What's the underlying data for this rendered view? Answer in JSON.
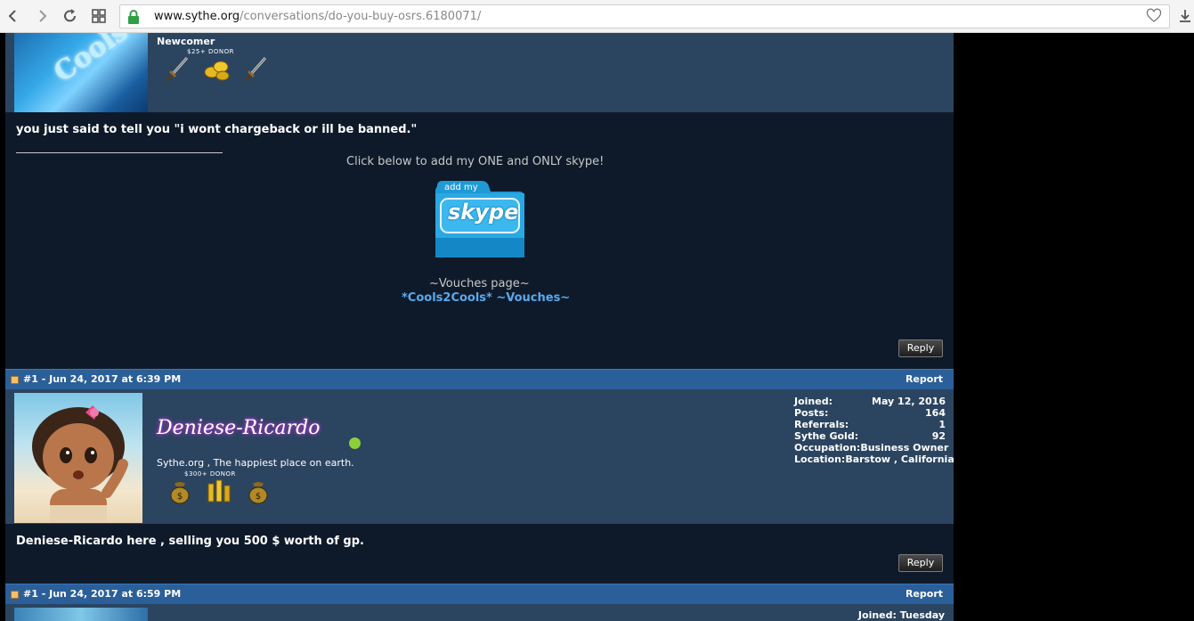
{
  "browser": {
    "url_host": "www.sythe.org",
    "url_path": "/conversations/do-you-buy-osrs.6180071/"
  },
  "post1": {
    "rank": "Newcomer",
    "badge_label": "$25+ DONOR",
    "message": "you just said to tell you \"i wont chargeback or ill be banned.\"",
    "signature": {
      "line1": "Click below to add my ONE and ONLY skype!",
      "skype_top": "add my",
      "skype_main": "skype",
      "vouches_title": "~Vouches page~",
      "vouches_link": "*Cools2Cools*  ~Vouches~"
    },
    "reply_label": "Reply",
    "avatar_text": "Cools"
  },
  "post2": {
    "meta": "#1 - Jun 24, 2017 at 6:39 PM",
    "report": "Report",
    "username": "Deniese-Ricardo",
    "tagline": "Sythe.org , The happiest place on earth.",
    "badge_label": "$300+ DONOR",
    "stats": [
      {
        "k": "Joined:",
        "v": "May 12, 2016"
      },
      {
        "k": "Posts:",
        "v": "164"
      },
      {
        "k": "Referrals:",
        "v": "1"
      },
      {
        "k": "Sythe Gold:",
        "v": "92"
      },
      {
        "k": "Occupation:",
        "v": "Business Owner"
      },
      {
        "k": "Location:",
        "v": "Barstow , California"
      }
    ],
    "message": "Deniese-Ricardo here , selling you 500 $ worth of gp.",
    "reply_label": "Reply"
  },
  "post3": {
    "meta": "#1 - Jun 24, 2017 at 6:59 PM",
    "report": "Report",
    "joined": "Joined: Tuesday"
  },
  "colors": {
    "header_blue": "#2b5f99",
    "userinfo_bg": "#2b4460",
    "body_bg": "#0e1a2a",
    "link": "#5aa9ee"
  }
}
